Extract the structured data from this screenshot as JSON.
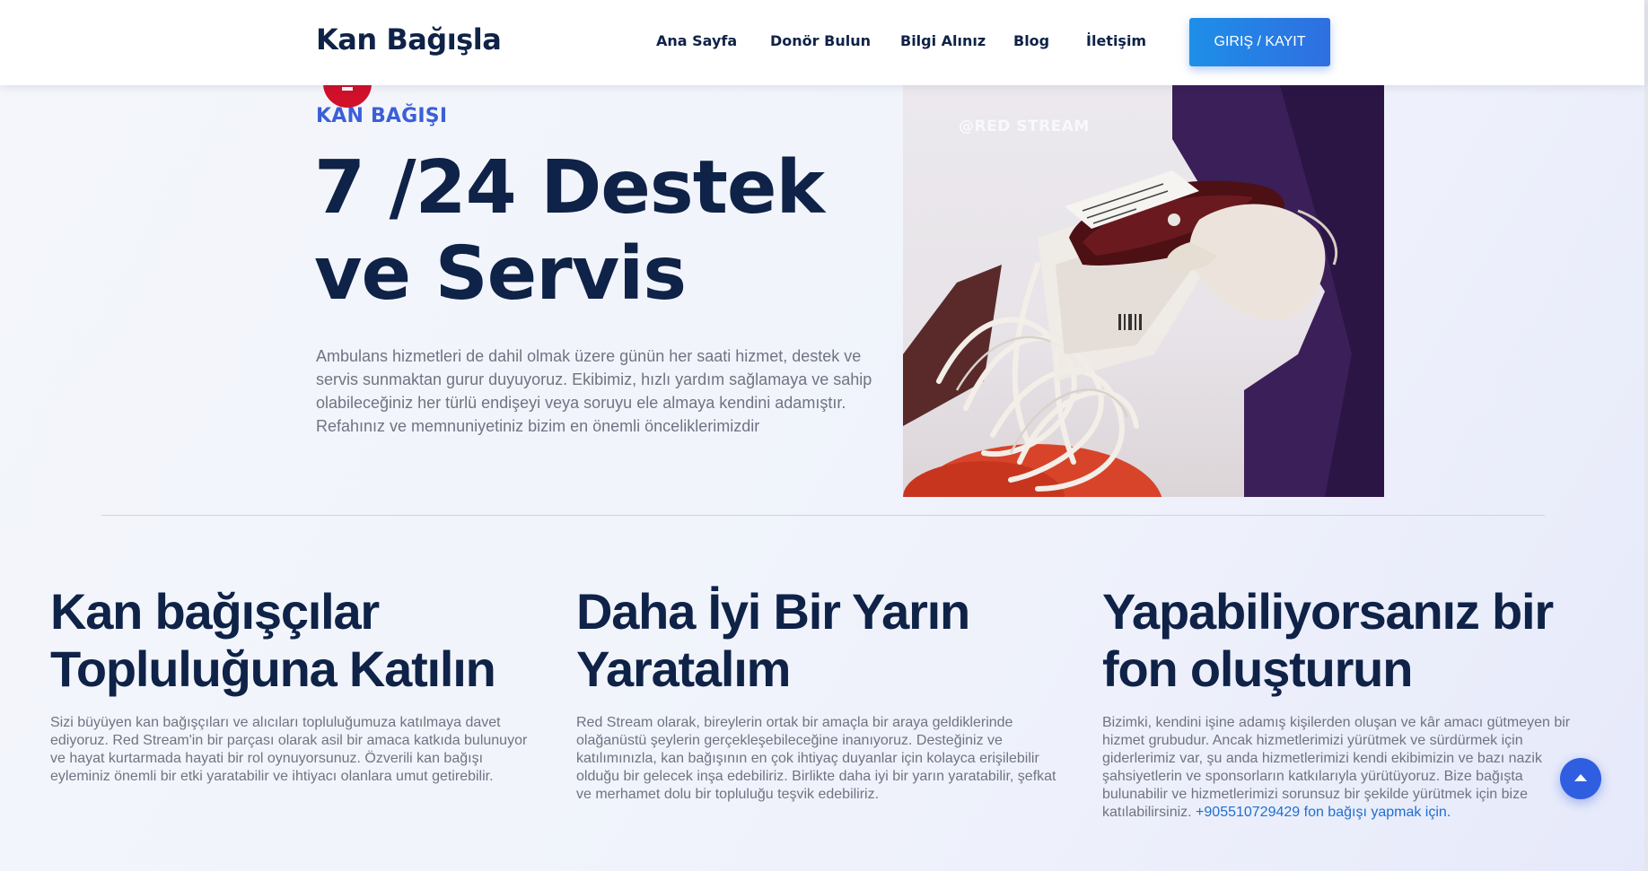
{
  "header": {
    "logo": "Kan Bağışla",
    "nav": [
      "Ana Sayfa",
      "Donör Bulun",
      "Bilgi Alınız",
      "Blog",
      "İletişim"
    ],
    "login_label": "GIRIŞ / KAYIT"
  },
  "hero": {
    "kicker": "KAN BAĞIŞI",
    "title": "7 /24 Destek ve Servis",
    "description": "Ambulans hizmetleri de dahil olmak üzere günün her saati hizmet, destek ve servis sunmaktan gurur duyuyoruz. Ekibimiz, hızlı yardım sağlamaya ve sahip olabileceğiniz her türlü endişeyi veya soruyu ele almaya kendini adamıştır. Refahınız ve memnuniyetiniz bizim en önemli önceliklerimizdir",
    "image_watermark": "@RED STREAM"
  },
  "features": [
    {
      "title": "Kan bağışçılar Topluluğuna Katılın",
      "text": "Sizi büyüyen kan bağışçıları ve alıcıları topluluğumuza katılmaya davet ediyoruz. Red Stream'in bir parçası olarak asil bir amaca katkıda bulunuyor ve hayat kurtarmada hayati bir rol oynuyorsunuz. Özverili kan bağışı eyleminiz önemli bir etki yaratabilir ve ihtiyacı olanlara umut getirebilir."
    },
    {
      "title": "Daha İyi Bir Yarın Yaratalım",
      "text": "Red Stream olarak, bireylerin ortak bir amaçla bir araya geldiklerinde olağanüstü şeylerin gerçekleşebileceğine inanıyoruz. Desteğiniz ve katılımınızla, kan bağışının en çok ihtiyaç duyanlar için kolayca erişilebilir olduğu bir gelecek inşa edebiliriz. Birlikte daha iyi bir yarın yaratabilir, şefkat ve merhamet dolu bir topluluğu teşvik edebiliriz."
    },
    {
      "title": "Yapabiliyorsanız bir fon oluşturun",
      "text": "Bizimki, kendini işine adamış kişilerden oluşan ve kâr amacı gütmeyen bir hizmet grubudur. Ancak hizmetlerimizi yürütmek ve sürdürmek için giderlerimiz var, şu anda hizmetlerimizi kendi ekibimizin ve bazı nazik şahsiyetlerin ve sponsorların katkılarıyla yürütüyoruz. Bize bağışta bulunabilir ve hizmetlerimizi sorunsuz bir şekilde yürütmek için bize katılabilirsiniz.",
      "link": "+905510729429 fon bağışı yapmak için."
    }
  ],
  "colors": {
    "navy": "#0f2247",
    "accent_blue": "#3b5fd8",
    "button_blue": "#1e8fe8",
    "brand_red": "#d1102a"
  },
  "icons": {
    "hero_badge": "blood-drop-icon",
    "scroll_top": "arrow-up-icon"
  }
}
